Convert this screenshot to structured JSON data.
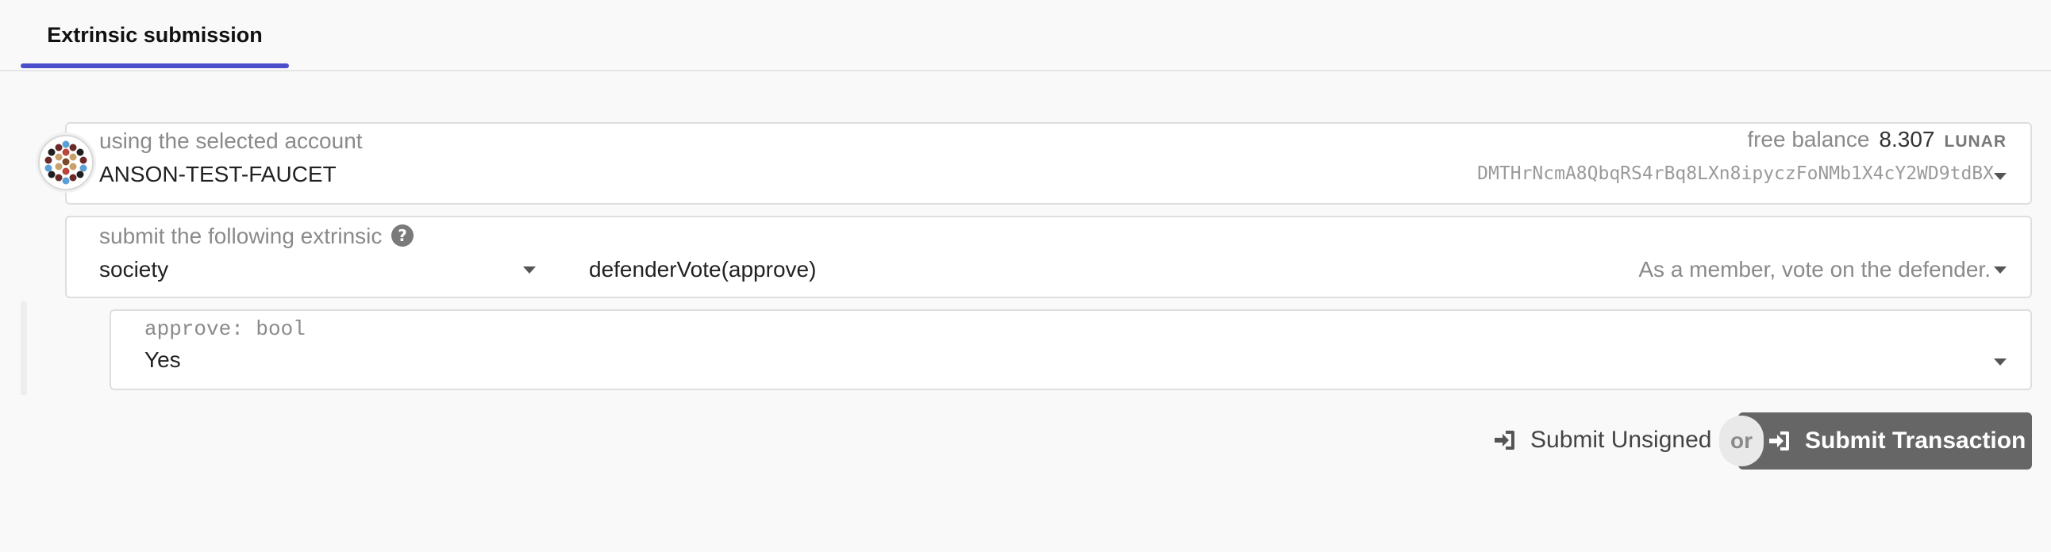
{
  "tabs": [
    {
      "label": "Extrinsic submission"
    }
  ],
  "account": {
    "label": "using the selected account",
    "name": "ANSON-TEST-FAUCET",
    "balance_label": "free balance",
    "balance_value": "8.307",
    "balance_unit": "LUNAR",
    "address": "DMTHrNcmA8QbqRS4rBq8LXn8ipyczFoNMb1X4cY2WD9tdBX"
  },
  "extrinsic": {
    "label": "submit the following extrinsic",
    "module": "society",
    "method": "defenderVote(approve)",
    "description": "As a member, vote on the defender."
  },
  "param": {
    "label": "approve: bool",
    "value": "Yes"
  },
  "actions": {
    "unsigned_label": "Submit Unsigned",
    "or_label": "or",
    "submit_label": "Submit Transaction"
  },
  "colors": {
    "accent": "#4b4ecb",
    "button_bg": "#666666"
  },
  "icons": [
    "help-icon",
    "sign-in-icon",
    "identicon-avatar",
    "chevron-down-icon"
  ]
}
